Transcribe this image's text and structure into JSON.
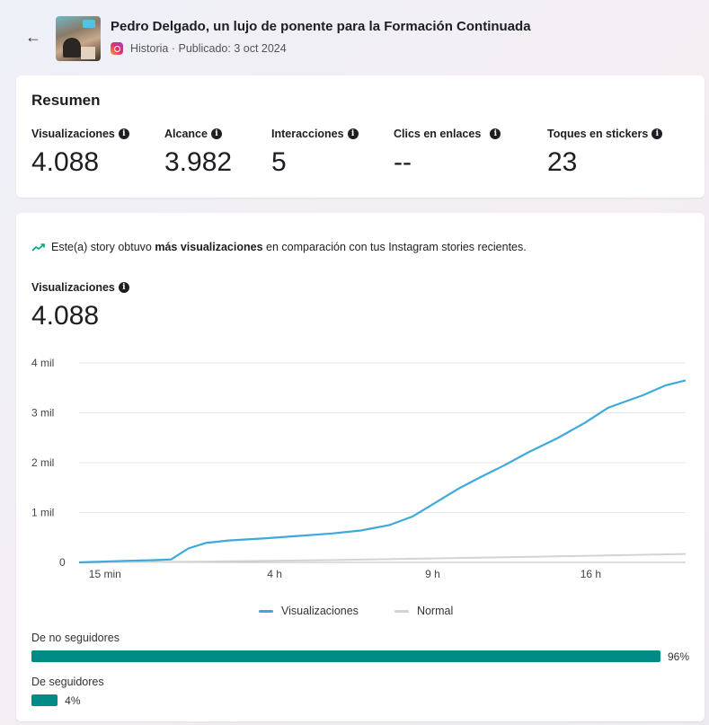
{
  "header": {
    "back_icon": "arrow-left-icon",
    "title": "Pedro Delgado, un lujo de ponente para la Formación Continuada",
    "subtitle": "Historia · Publicado: 3 oct 2024",
    "platform_icon": "instagram-icon"
  },
  "summary": {
    "heading": "Resumen",
    "metrics": [
      {
        "label": "Visualizaciones",
        "value": "4.088"
      },
      {
        "label": "Alcance",
        "value": "3.982"
      },
      {
        "label": "Interacciones",
        "value": "5"
      },
      {
        "label": "Clics en enlaces",
        "value": "--"
      },
      {
        "label": "Toques en stickers",
        "value": "23"
      }
    ]
  },
  "insight": {
    "icon": "trend-up-icon",
    "text_before": "Este(a) story obtuvo ",
    "text_bold": "más visualizaciones",
    "text_after": " en comparación con tus Instagram stories recientes."
  },
  "chart_section": {
    "label": "Visualizaciones",
    "value": "4.088"
  },
  "chart_data": {
    "type": "line",
    "y_tick_labels": [
      "0",
      "1 mil",
      "2 mil",
      "3 mil",
      "4 mil"
    ],
    "y_tick_values": [
      0,
      1000,
      2000,
      3000,
      4000
    ],
    "ylim": [
      0,
      4000
    ],
    "x_tick_labels": [
      "15 min",
      "4 h",
      "9 h",
      "16 h"
    ],
    "grid": true,
    "legend_position": "bottom",
    "series": [
      {
        "name": "Visualizaciones",
        "color": "#3fa9dc",
        "points": [
          [
            0.0,
            0
          ],
          [
            0.3,
            10
          ],
          [
            0.8,
            30
          ],
          [
            1.3,
            45
          ],
          [
            1.6,
            60
          ],
          [
            1.9,
            280
          ],
          [
            2.2,
            390
          ],
          [
            2.6,
            440
          ],
          [
            3.2,
            480
          ],
          [
            3.8,
            530
          ],
          [
            4.4,
            580
          ],
          [
            4.9,
            640
          ],
          [
            5.4,
            750
          ],
          [
            5.8,
            920
          ],
          [
            6.2,
            1200
          ],
          [
            6.6,
            1480
          ],
          [
            7.0,
            1720
          ],
          [
            7.4,
            1950
          ],
          [
            7.8,
            2200
          ],
          [
            8.3,
            2480
          ],
          [
            8.8,
            2800
          ],
          [
            9.2,
            3100
          ],
          [
            9.8,
            3350
          ],
          [
            10.2,
            3550
          ],
          [
            10.55,
            3650
          ]
        ]
      },
      {
        "name": "Normal",
        "color": "#d3d3d3",
        "points": [
          [
            0.0,
            0
          ],
          [
            2.0,
            15
          ],
          [
            4.0,
            40
          ],
          [
            6.0,
            75
          ],
          [
            8.0,
            115
          ],
          [
            10.55,
            170
          ]
        ]
      }
    ]
  },
  "audience": {
    "non_followers_label": "De no seguidores",
    "non_followers_pct": "96%",
    "non_followers_value": 96,
    "followers_label": "De seguidores",
    "followers_pct": "4%",
    "followers_value": 4,
    "bar_color": "#008b86"
  }
}
